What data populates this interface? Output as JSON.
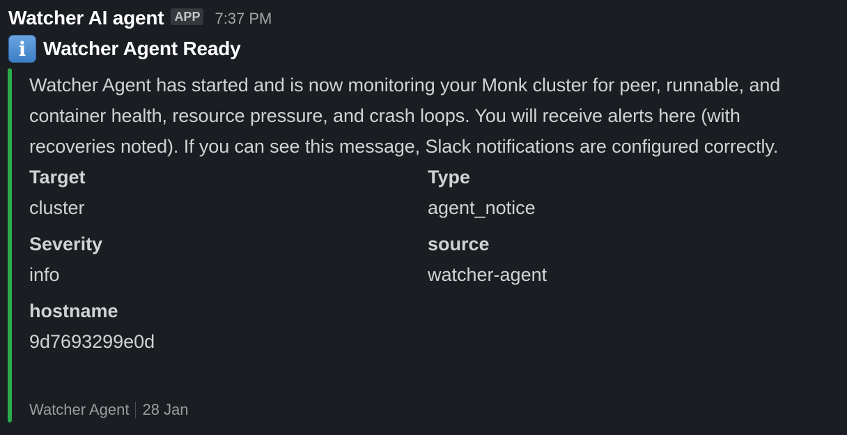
{
  "message": {
    "sender": "Watcher AI agent",
    "app_badge": "APP",
    "timestamp": "7:37 PM",
    "title_icon": "information-icon",
    "title": "Watcher Agent Ready",
    "accent_color": "#2bac4a",
    "body": "Watcher Agent has started and is now monitoring your Monk cluster for peer, runnable, and container health, resource pressure, and crash loops. You will receive alerts here (with recoveries noted). If you can see this message, Slack notifications are configured correctly.",
    "fields": [
      {
        "label": "Target",
        "value": "cluster"
      },
      {
        "label": "Type",
        "value": "agent_notice"
      },
      {
        "label": "Severity",
        "value": "info"
      },
      {
        "label": "source",
        "value": "watcher-agent"
      },
      {
        "label": "hostname",
        "value": "9d7693299e0d"
      }
    ],
    "footer": {
      "author": "Watcher Agent",
      "date": "28 Jan"
    }
  }
}
